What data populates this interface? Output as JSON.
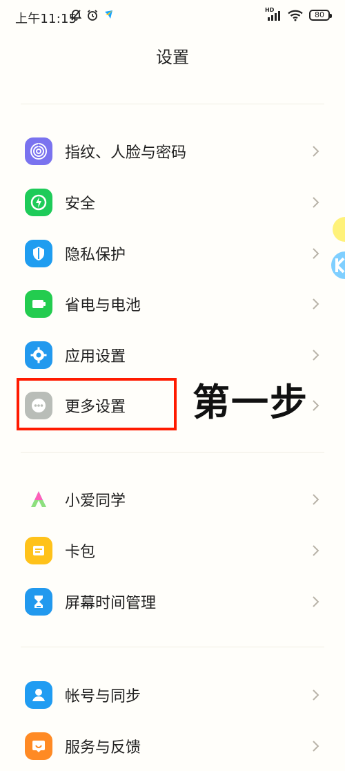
{
  "status_bar": {
    "time": "上午11:15",
    "network_label": "HD",
    "battery": "80"
  },
  "header": {
    "title": "设置"
  },
  "sections": {
    "main": [
      {
        "label": "指纹、人脸与密码",
        "icon": "fingerprint-icon",
        "color": "#7a73ef"
      },
      {
        "label": "安全",
        "icon": "security-shield-icon",
        "color": "#1ecb59"
      },
      {
        "label": "隐私保护",
        "icon": "privacy-icon",
        "color": "#1f9df0"
      },
      {
        "label": "省电与电池",
        "icon": "battery-saver-icon",
        "color": "#23cc4f"
      },
      {
        "label": "应用设置",
        "icon": "app-settings-gear-icon",
        "color": "#2299ee"
      },
      {
        "label": "更多设置",
        "icon": "more-settings-dots-icon",
        "color": "#b9bdb8"
      }
    ],
    "services": [
      {
        "label": "小爱同学",
        "icon": "xiaoai-assistant-icon",
        "color": "#7fd6ff"
      },
      {
        "label": "卡包",
        "icon": "card-wallet-icon",
        "color": "#ffc21a"
      },
      {
        "label": "屏幕时间管理",
        "icon": "hourglass-screen-time-icon",
        "color": "#2299ee"
      }
    ],
    "account": [
      {
        "label": "帐号与同步",
        "icon": "account-user-icon",
        "color": "#209cf2"
      },
      {
        "label": "服务与反馈",
        "icon": "feedback-icon",
        "color": "#ff8a24"
      }
    ]
  },
  "annotation": {
    "step_text": "第一步",
    "box_color": "#ff1a00"
  }
}
